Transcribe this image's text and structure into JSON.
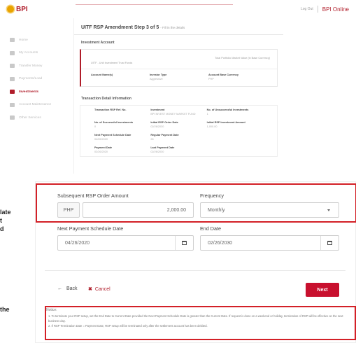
{
  "header": {
    "logo_text": "BPI",
    "logout_label": "Log Out",
    "brand_label": "BPI Online"
  },
  "sidebar": {
    "items": [
      {
        "label": "Home",
        "icon": "home-icon",
        "active": false
      },
      {
        "label": "My Accounts",
        "icon": "accounts-icon",
        "active": false
      },
      {
        "label": "Transfer Money",
        "icon": "transfer-icon",
        "active": false
      },
      {
        "label": "Payments/Load",
        "icon": "payments-icon",
        "active": false
      },
      {
        "label": "Investments",
        "icon": "chart-icon",
        "active": true
      },
      {
        "label": "Account Maintenance",
        "icon": "user-icon",
        "active": false
      },
      {
        "label": "Other Services",
        "icon": "menu-icon",
        "active": false
      }
    ]
  },
  "content": {
    "title": "UITF RSP Amendment Step 3 of 5",
    "subtitle": "- Fill in the details",
    "investment_account_section": "Investment Account",
    "total_value_label": "Total Portfolio Market Value (in Base Currency)",
    "fund_label": "UITF - Unit Investment Trust Funds",
    "fields": [
      {
        "label": "Account Name(s)",
        "value": ""
      },
      {
        "label": "Investor Type",
        "value": "Aggressive"
      },
      {
        "label": "Account Base Currency",
        "value": "PHP"
      }
    ],
    "transaction_section": "Transaction Detail Information",
    "transaction_fields": [
      {
        "label": "Transaction RSP Ref. No.",
        "value": ""
      },
      {
        "label": "Investment",
        "value": "BPI INVEST MONEY MARKET FUND"
      },
      {
        "label": "No. of Unsuccessful Investments",
        "value": "1"
      },
      {
        "label": "No. of Successful Investments",
        "value": "0"
      },
      {
        "label": "Initial RSP Order Date",
        "value": "02/26/2030"
      },
      {
        "label": "Initial RSP Investment Amount",
        "value": "1,000.00"
      },
      {
        "label": "Next Payment Schedule Date",
        "value": "04/26/2020"
      },
      {
        "label": "Regular Payment Date",
        "value": "26"
      },
      {
        "label": "",
        "value": ""
      },
      {
        "label": "Payment Date",
        "value": "02/26/2020"
      },
      {
        "label": "Last Payment Date",
        "value": "02/26/2030"
      },
      {
        "label": "",
        "value": ""
      }
    ]
  },
  "form": {
    "amount_label": "Subsequent RSP Order Amount",
    "currency": "PHP",
    "amount_value": "2,000.00",
    "frequency_label": "Frequency",
    "frequency_value": "Monthly",
    "next_date_label": "Next Payment Schedule Date",
    "next_date_value": "04/26/2020",
    "end_date_label": "End Date",
    "end_date_value": "02/26/2030"
  },
  "actions": {
    "back_label": "Back",
    "cancel_label": "Cancel",
    "next_label": "Next"
  },
  "notice": {
    "title": "Notice:",
    "items": [
      "1.   To terminate your RSP setup, set the End Date to Current Date provided the Next Payment Schedule Date is greater than the Current Date. If request is done on a weekend or holiday, termination of RSP will be effective on the next business day.",
      "2.   If RSP Termination Date = Payment Date, RSP setup will be terminated only after the settlement account has been debited."
    ]
  },
  "left_fragments": [
    "late",
    "t",
    "d",
    "the"
  ],
  "colors": {
    "brand_red": "#b01d2a",
    "button_red": "#c8102e",
    "highlight_red": "#d32027"
  }
}
